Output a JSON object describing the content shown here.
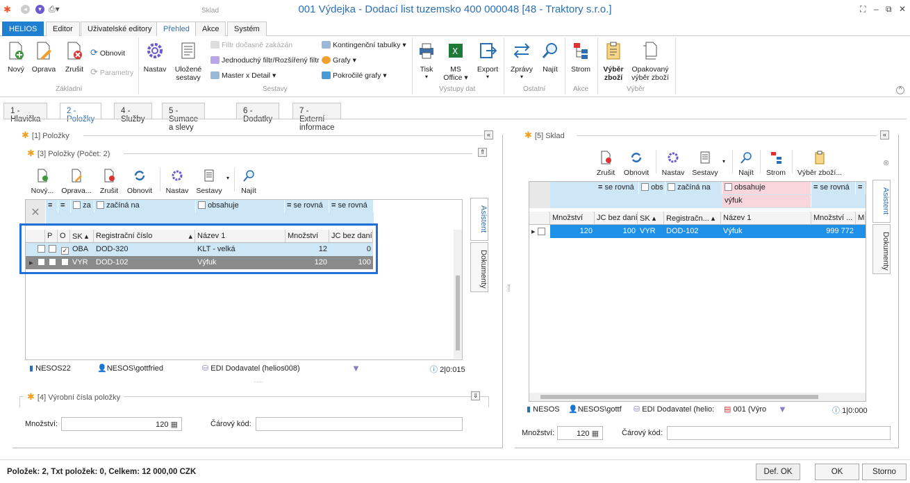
{
  "window": {
    "title": "001  Výdejka - Dodací list tuzemsko  400 000048 [48 - Traktory s.r.o.]",
    "app_name": "Sklad"
  },
  "ribbon_tabs": [
    "HELIOS",
    "Editor",
    "Uživatelské editory",
    "Přehled",
    "Akce",
    "Systém"
  ],
  "ribbon": {
    "zakladni": {
      "novy": "Nový",
      "oprava": "Oprava",
      "zrusit": "Zrušit",
      "obnovit": "Obnovit",
      "parametry": "Parametry",
      "group": "Základní"
    },
    "sestavy": {
      "nastav": "Nastav",
      "ulozene1": "Uložené",
      "ulozene2": "sestavy",
      "filtr_zakazan": "Filtr dočasně zakázán",
      "jednoduchy_filtr": "Jednoduchý filtr/Rozšířený filtr",
      "master_detail": "Master x Detail",
      "kontingencni": "Kontingenční tabulky",
      "grafy": "Grafy",
      "pokrocile_grafy": "Pokročilé grafy",
      "group": "Sestavy"
    },
    "vystupy": {
      "tisk": "Tisk",
      "ms1": "MS",
      "ms2": "Office",
      "export": "Export",
      "group": "Výstupy dat"
    },
    "ostatni": {
      "zpravy": "Zprávy",
      "najit": "Najít",
      "group": "Ostatní"
    },
    "akce": {
      "strom": "Strom",
      "group": "Akce"
    },
    "vyber": {
      "vyber1": "Výběr",
      "vyber2": "zboží",
      "opak1": "Opakovaný",
      "opak2": "výběr zboží",
      "group": "Výběr"
    }
  },
  "doc_tabs": [
    "1 - Hlavička",
    "2 - Položky",
    "4 - Služby",
    "5 - Sumace a slevy",
    "6 - Dodatky",
    "7 - Externí informace"
  ],
  "left": {
    "panel_title": "[1] Položky",
    "sub_title": "[3] Položky (Počet: 2)",
    "toolbar": {
      "novy": "Nový...",
      "oprava": "Oprava...",
      "zrusit": "Zrušit",
      "obnovit": "Obnovit",
      "nastav": "Nastav",
      "sestavy": "Sestavy",
      "najit": "Najít"
    },
    "filter": {
      "c1": "=",
      "c2": "=",
      "c3": "za",
      "c4": "začíná na",
      "c5": "obsahuje",
      "c6": "se rovná",
      "c7": "se rovná"
    },
    "headers": {
      "p": "P",
      "o": "O",
      "sk": "SK",
      "reg": "Registrační číslo",
      "nazev": "Název 1",
      "mnozstvi": "Množství",
      "jc": "JC bez daní"
    },
    "rows": [
      {
        "p": false,
        "o": true,
        "sk": "OBA",
        "reg": "DOD-320",
        "nazev": "KLT - velká",
        "mnozstvi": "12",
        "jc": "0"
      },
      {
        "p": false,
        "o": false,
        "sk": "VYR",
        "reg": "DOD-102",
        "nazev": "Výfuk",
        "mnozstvi": "120",
        "jc": "100"
      }
    ],
    "side_tabs": {
      "asistent": "Asistent",
      "dokumenty": "Dokumenty"
    },
    "status": {
      "server": "NESOS22",
      "user": "NESOS\\gottfried",
      "db": "EDI Dodavatel (helios008)",
      "info": "2|0:015"
    },
    "sub2_title": "[4] Výrobní čísla položky",
    "mnozstvi_label": "Množství:",
    "mnozstvi_value": "120",
    "carovy_label": "Čárový kód:",
    "carovy_value": ""
  },
  "right": {
    "panel_title": "[5] Sklad",
    "toolbar": {
      "zrusit": "Zrušit",
      "obnovit": "Obnovit",
      "nastav": "Nastav",
      "sestavy": "Sestavy",
      "najit": "Najít",
      "strom": "Strom",
      "vyber": "Výběr zboží..."
    },
    "filter": {
      "c1": "se rovná",
      "c2": "obs",
      "c3": "začíná na",
      "c4": "obsahuje",
      "c5": "se rovná",
      "c6": "="
    },
    "filter_value": "výfuk",
    "headers": {
      "mnozstvi": "Množství",
      "jc": "JC bez daní",
      "sk": "SK",
      "reg": "Registračn...",
      "nazev": "Název 1",
      "mnozstvi2": "Množství ...",
      "mr": "Mr"
    },
    "rows": [
      {
        "mnozstvi": "120",
        "jc": "100",
        "sk": "VYR",
        "reg": "DOD-102",
        "nazev": "Výfuk",
        "mnozstvi2": "999 772"
      }
    ],
    "side_tabs": {
      "asistent": "Asistent",
      "dokumenty": "Dokumenty"
    },
    "status": {
      "server": "NESOS",
      "user": "NESOS\\gottf",
      "db": "EDI Dodavatel (helio:",
      "org": "001 (Výro",
      "info": "1|0:000"
    },
    "mnozstvi_label": "Množství:",
    "mnozstvi_value": "120",
    "carovy_label": "Čárový kód:",
    "carovy_value": ""
  },
  "footer": {
    "summary": "Položek: 2,  Txt položek: 0,  Celkem: 12 000,00 CZK",
    "def_ok": "Def. OK",
    "ok": "OK",
    "storno": "Storno"
  },
  "colors": {
    "accent": "#1f7fd1",
    "highlight": "#1e6fd9",
    "filter_bg": "#cde7f7",
    "selected_row": "#1e90e8"
  }
}
